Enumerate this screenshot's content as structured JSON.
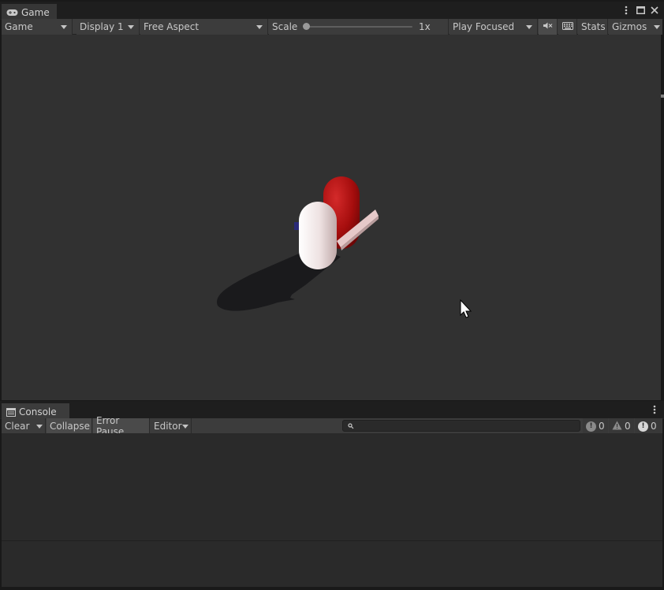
{
  "game_tab": {
    "label": "Game"
  },
  "game_toolbar": {
    "mode": "Game",
    "display": "Display 1",
    "aspect": "Free Aspect",
    "scale_label": "Scale",
    "scale_value": "1x",
    "play_mode": "Play Focused",
    "stats": "Stats",
    "gizmos": "Gizmos"
  },
  "console_tab": {
    "label": "Console"
  },
  "console_toolbar": {
    "clear": "Clear",
    "collapse": "Collapse",
    "error_pause": "Error Pause",
    "editor": "Editor",
    "search_placeholder": "",
    "info_count": "0",
    "warning_count": "0",
    "error_count": "0"
  },
  "colors": {
    "viewport_bg": "#313131",
    "red_capsule": "#b01010",
    "white_capsule": "#e9dcdc"
  }
}
